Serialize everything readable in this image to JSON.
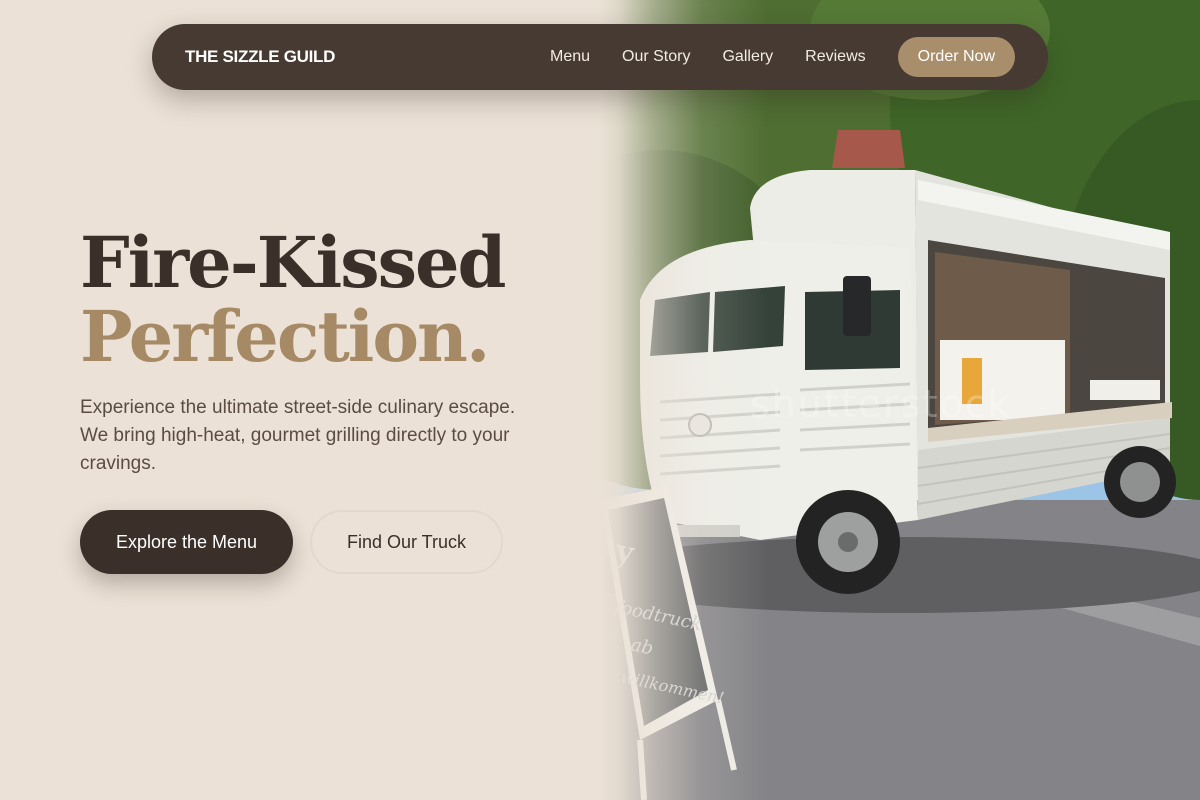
{
  "nav": {
    "brand": "THE SIZZLE GUILD",
    "links": [
      "Menu",
      "Our Story",
      "Gallery",
      "Reviews"
    ],
    "cta": "Order Now"
  },
  "hero": {
    "title_line1": "Fire-Kissed",
    "title_line2": "Perfection.",
    "description": "Experience the ultimate street-side culinary escape. We bring high-heat, gourmet grilling directly to your cravings.",
    "primary_button": "Explore the Menu",
    "secondary_button": "Find Our Truck"
  },
  "photo": {
    "watermark": "shutterstock",
    "sign_text": [
      "foodtruck",
      "ab",
      "willkommen!"
    ]
  },
  "colors": {
    "background": "#ebe1d6",
    "nav_bg": "#463a32",
    "accent": "#a98e6c",
    "text_dark": "#3b2f29",
    "title_accent": "#a68a66"
  }
}
